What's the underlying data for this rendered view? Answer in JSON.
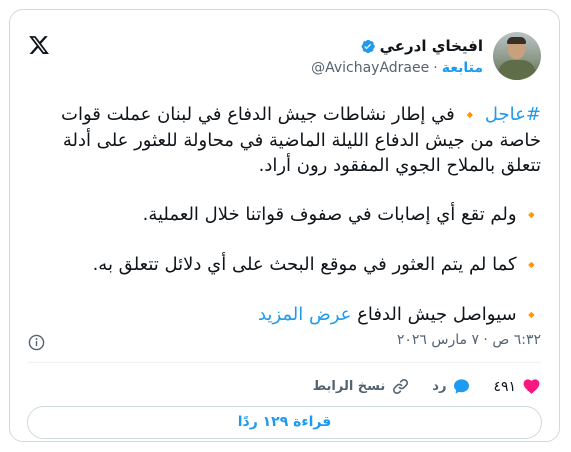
{
  "author": {
    "display_name": "افيخاي ادرعي",
    "handle": "@AvichayAdraee",
    "follow_label": "متابعة",
    "separator": "·"
  },
  "tweet": {
    "hashtag": "#عاجل",
    "line1_text": " في إطار نشاطات جيش الدفاع في لبنان عملت قوات خاصة من جيش الدفاع الليلة الماضية في محاولة للعثور على أدلة تتعلق بالملاح الجوي المفقود رون أراد.",
    "line2_text": " ولم تقع أي إصابات في صفوف قواتنا خلال العملية.",
    "line3_text": " كما لم يتم العثور في موقع البحث على أي دلائل تتعلق به.",
    "line4_text": " سيواصل جيش الدفاع ",
    "show_more": "عرض المزيد",
    "bullet": "🔸"
  },
  "meta": {
    "timestamp": "٦:٣٢ ص · ٧ مارس ٢٠٢٦"
  },
  "actions": {
    "like_count": "٤٩١",
    "reply_label": "رد",
    "copy_link_label": "نسخ الرابط"
  },
  "read_replies_label": "قراءة ١٢٩ ردًا",
  "colors": {
    "accent": "#1d9bf0",
    "like": "#f91880",
    "diamond": "#f4900c"
  }
}
